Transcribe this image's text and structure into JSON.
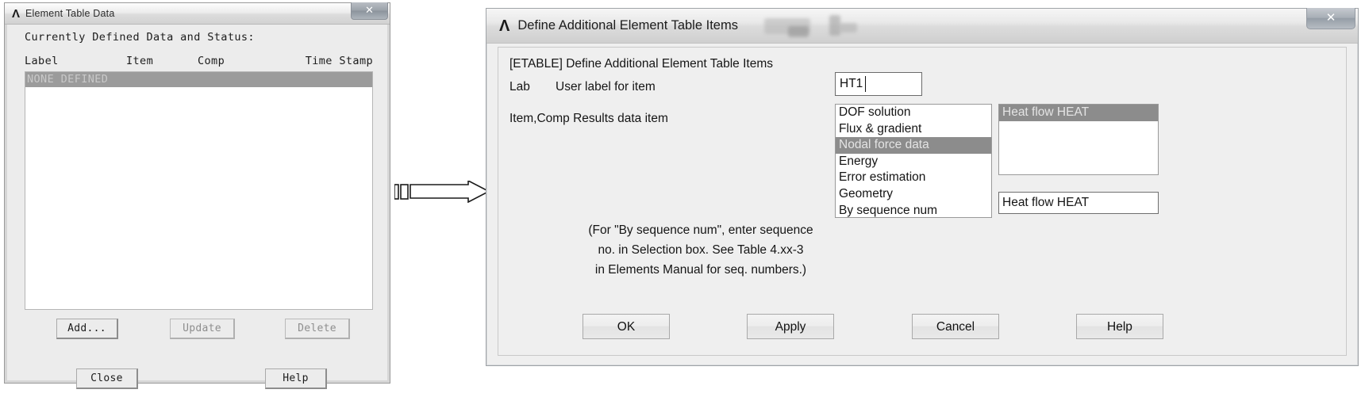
{
  "left_dialog": {
    "title": "Element Table Data",
    "logo": "ansys-logo",
    "close_glyph": "✕",
    "heading": "Currently Defined Data and Status:",
    "columns": [
      "Label",
      "Item",
      "Comp",
      "Time Stamp"
    ],
    "rows": [
      "NONE DEFINED"
    ],
    "buttons": {
      "add": "Add...",
      "update": "Update",
      "delete": "Delete",
      "close": "Close",
      "help": "Help"
    }
  },
  "annotation": {
    "arrow": "right-block-arrow"
  },
  "right_dialog": {
    "title": "Define Additional Element Table Items",
    "logo": "ansys-logo",
    "close_glyph": "✕",
    "command_heading": "[ETABLE]  Define Additional Element Table Items",
    "lab_label": "Lab",
    "lab_sublabel": "User label for item",
    "lab_value": "HT1",
    "itemcomp_label": "Item,Comp  Results data item",
    "item_list": [
      "DOF solution",
      "Flux & gradient",
      "Nodal force data",
      "Energy",
      "Error estimation",
      "Geometry",
      "By sequence num"
    ],
    "item_selected_index": 2,
    "comp_list": [
      "Heat flow   HEAT"
    ],
    "comp_selected_index": 0,
    "comp_value": "Heat flow   HEAT",
    "note_lines": [
      "(For \"By sequence num\", enter sequence",
      "no. in Selection box.  See Table 4.xx-3",
      "in Elements Manual for seq. numbers.)"
    ],
    "buttons": {
      "ok": "OK",
      "apply": "Apply",
      "cancel": "Cancel",
      "help": "Help"
    }
  },
  "colors": {
    "selection": "#8c8c8c",
    "dialog_bg": "#efefef",
    "legacy_bg": "#ececec"
  }
}
